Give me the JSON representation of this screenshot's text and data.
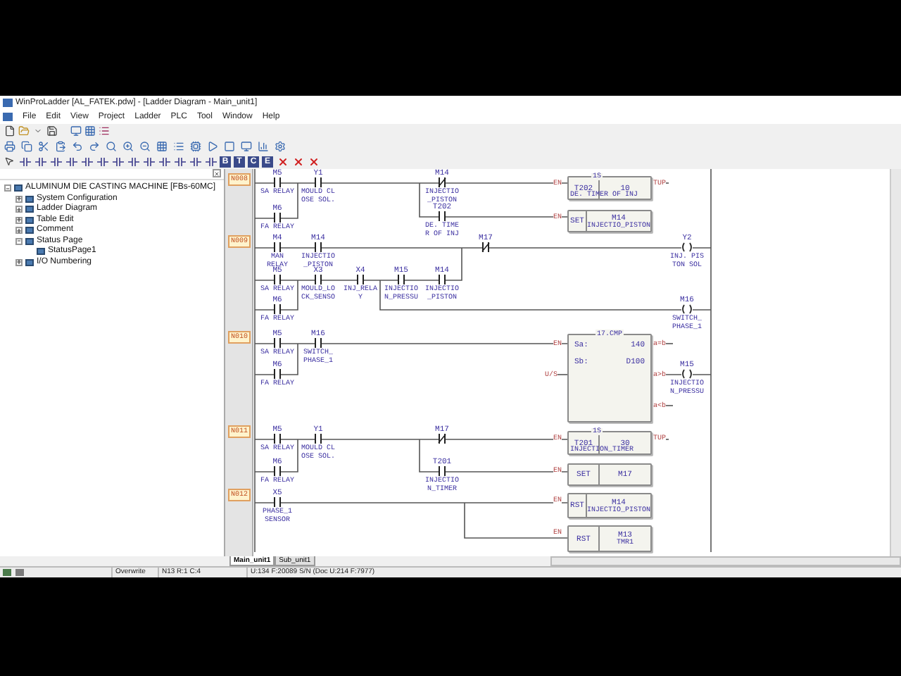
{
  "window": {
    "title": "WinProLadder [AL_FATEK.pdw] - [Ladder Diagram - Main_unit1]"
  },
  "menu": [
    "File",
    "Edit",
    "View",
    "Project",
    "Ladder",
    "PLC",
    "Tool",
    "Window",
    "Help"
  ],
  "toolbar": {
    "letter_buttons": [
      "B",
      "T",
      "C",
      "E"
    ]
  },
  "tree": [
    {
      "label": "ALUMINUM DIE CASTING MACHINE [FBs-60MC]",
      "expanded": true,
      "children": [
        {
          "label": "System Configuration",
          "expanded": false
        },
        {
          "label": "Ladder Diagram",
          "expanded": false
        },
        {
          "label": "Table Edit",
          "expanded": false
        },
        {
          "label": "Comment",
          "expanded": false
        },
        {
          "label": "Status Page",
          "expanded": true,
          "children": [
            {
              "label": "StatusPage1"
            }
          ]
        },
        {
          "label": "I/O Numbering",
          "expanded": false
        }
      ]
    }
  ],
  "ladder": {
    "rungs": [
      {
        "number": "N008",
        "elements": [
          {
            "kind": "contact",
            "address": "M5",
            "label": "SA RELAY"
          },
          {
            "kind": "contact",
            "address": "Y1",
            "label": "MOULD CL\nOSE SOL."
          },
          {
            "kind": "contact",
            "address": "M6",
            "label": "FA RELAY"
          },
          {
            "kind": "contact_nc",
            "address": "M14",
            "label": "INJECTIO\n_PISTON"
          },
          {
            "kind": "contact",
            "address": "T202",
            "label": "DE. TIME\nR OF INJ"
          },
          {
            "kind": "timer",
            "input": "EN",
            "top": "1S",
            "address": "T202",
            "value": "10",
            "comment": "DE. TIMER OF INJ",
            "output": "TUP"
          },
          {
            "kind": "function",
            "input": "EN",
            "op": "SET",
            "address": "M14",
            "comment": "INJECTIO_PISTON"
          }
        ]
      },
      {
        "number": "N009",
        "elements": [
          {
            "kind": "contact",
            "address": "M4",
            "label": "MAN\nRELAY"
          },
          {
            "kind": "contact",
            "address": "M14",
            "label": "INJECTIO\n_PISTON"
          },
          {
            "kind": "contact_nc",
            "address": "M17"
          },
          {
            "kind": "coil",
            "address": "Y2",
            "label": "INJ. PIS\nTON SOL"
          },
          {
            "kind": "contact",
            "address": "M5",
            "label": "SA RELAY"
          },
          {
            "kind": "contact",
            "address": "X3",
            "label": "MOULD_LO\nCK_SENSO"
          },
          {
            "kind": "contact",
            "address": "X4",
            "label": "INJ_RELA\nY"
          },
          {
            "kind": "contact",
            "address": "M15",
            "label": "INJECTIO\nN_PRESSU"
          },
          {
            "kind": "contact",
            "address": "M14",
            "label": "INJECTIO\n_PISTON"
          },
          {
            "kind": "contact",
            "address": "M6",
            "label": "FA RELAY"
          },
          {
            "kind": "coil",
            "address": "M16",
            "label": "SWITCH_\nPHASE_1"
          }
        ]
      },
      {
        "number": "N010",
        "elements": [
          {
            "kind": "contact",
            "address": "M5",
            "label": "SA RELAY"
          },
          {
            "kind": "contact",
            "address": "M16",
            "label": "SWITCH_\nPHASE_1"
          },
          {
            "kind": "cmp",
            "inputs": [
              "EN",
              "U/S"
            ],
            "top": "17.CMP",
            "operands": [
              {
                "label": "Sa:",
                "value": "140"
              },
              {
                "label": "Sb:",
                "value": "D100"
              }
            ],
            "outputs": [
              "a=b",
              "a>b",
              "a<b"
            ]
          },
          {
            "kind": "contact",
            "address": "M6",
            "label": "FA RELAY"
          },
          {
            "kind": "coil",
            "address": "M15",
            "label": "INJECTIO\nN_PRESSU"
          }
        ]
      },
      {
        "number": "N011",
        "elements": [
          {
            "kind": "contact",
            "address": "M5",
            "label": "SA RELAY"
          },
          {
            "kind": "contact",
            "address": "Y1",
            "label": "MOULD CL\nOSE SOL."
          },
          {
            "kind": "contact",
            "address": "M6",
            "label": "FA RELAY"
          },
          {
            "kind": "contact_nc",
            "address": "M17"
          },
          {
            "kind": "contact",
            "address": "T201",
            "label": "INJECTIO\nN_TIMER"
          },
          {
            "kind": "timer",
            "input": "EN",
            "top": "1S",
            "address": "T201",
            "value": "30",
            "comment": "INJECTION_TIMER",
            "output": "TUP"
          },
          {
            "kind": "function",
            "input": "EN",
            "op": "SET",
            "address": "M17"
          }
        ]
      },
      {
        "number": "N012",
        "elements": [
          {
            "kind": "contact",
            "address": "X5",
            "label": "PHASE_1\nSENSOR"
          },
          {
            "kind": "function",
            "input": "EN",
            "op": "RST",
            "address": "M14",
            "comment": "INJECTIO_PISTON"
          },
          {
            "kind": "function",
            "input": "EN",
            "op": "RST",
            "address": "M13",
            "comment": "TMR1"
          }
        ]
      }
    ]
  },
  "tabs": [
    {
      "label": "Main_unit1",
      "selected": true
    },
    {
      "label": "Sub_unit1",
      "selected": false
    }
  ],
  "status_bar": [
    "Overwrite",
    "N13 R:1 C:4",
    "U:134 F:20089 S/N (Doc U:214 F:7977)"
  ]
}
